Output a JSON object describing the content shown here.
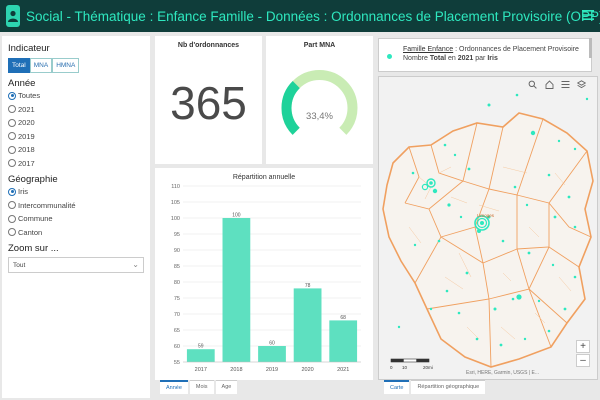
{
  "header": {
    "title": "Social - Thématique : Enfance Famille - Données : Ordonnances de Placement Provisoire (OPP)",
    "menu_icon": "hamburger-icon",
    "logo_icon": "person-icon",
    "accent": "#2ee8bf",
    "bg": "#0f3d3a"
  },
  "sidebar": {
    "indicator_heading": "Indicateur",
    "indicator_options": [
      "Total",
      "MNA",
      "HMNA"
    ],
    "year_heading": "Année",
    "year_options": [
      "Toutes",
      "2021",
      "2020",
      "2019",
      "2018",
      "2017"
    ],
    "year_selected": "Toutes",
    "geo_heading": "Géographie",
    "geo_options": [
      "Iris",
      "Intercommunalité",
      "Commune",
      "Canton"
    ],
    "geo_selected": "Iris",
    "zoom_heading": "Zoom sur ...",
    "zoom_value": "Tout"
  },
  "kpi": {
    "count_title": "Nb d'ordonnances",
    "count_value": "365",
    "share_title": "Part MNA",
    "share_value": "33,4%",
    "share_fraction": 0.334
  },
  "chart_card": {
    "title": "Répartition annuelle",
    "tabs": [
      "Année",
      "Mois",
      "Age"
    ],
    "active_tab": "Année"
  },
  "chart_data": {
    "type": "bar",
    "title": "Répartition annuelle",
    "categories": [
      "2017",
      "2018",
      "2019",
      "2020",
      "2021"
    ],
    "values": [
      59,
      100,
      60,
      78,
      68
    ],
    "ylim": [
      55,
      110
    ],
    "yticks": [
      55,
      60,
      65,
      70,
      75,
      80,
      85,
      90,
      95,
      100,
      105,
      110
    ],
    "bar_color": "#5ee0c0",
    "grid": true
  },
  "map": {
    "legend_link": "Famille Enfance",
    "legend_rest": " : Ordonnances de Placement Provisoire",
    "legend_line2_a": "Nombre ",
    "legend_line2_b": "Total",
    "legend_line2_c": " en ",
    "legend_line2_d": "2021",
    "legend_line2_e": " par ",
    "legend_line2_f": "Iris",
    "attribution": "Esri, HERE, Garmin, USGS | E...",
    "scale_labels": [
      "0",
      "10",
      "20mi"
    ],
    "tabs": [
      "Carte",
      "Répartition géographique"
    ],
    "active_tab": "Carte",
    "tools": [
      "search-icon",
      "home-icon",
      "list-icon",
      "layers-icon"
    ]
  }
}
